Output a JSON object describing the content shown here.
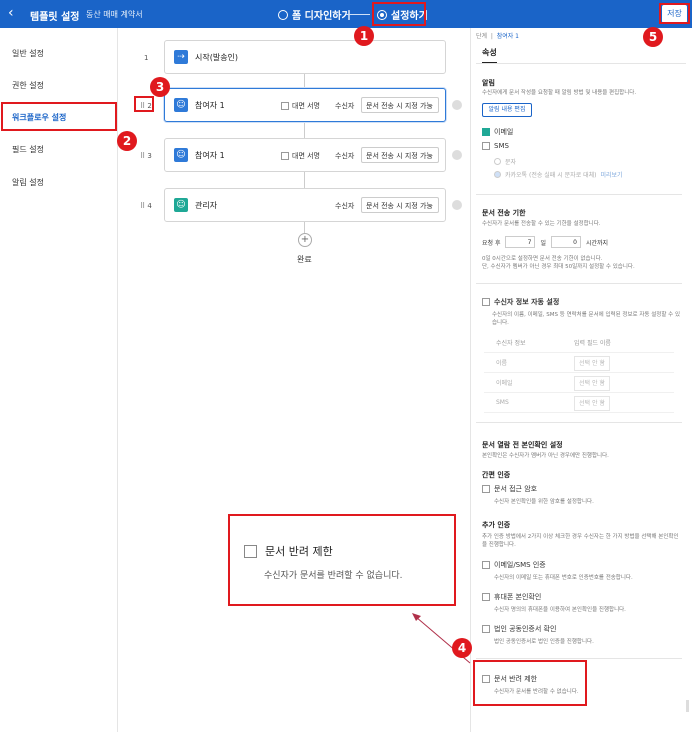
{
  "header": {
    "back_icon": "chevron-left-icon",
    "title": "템플릿 설정",
    "subtitle": "동산 매매 계약서",
    "steps": [
      {
        "label": "폼 디자인하기",
        "selected": false
      },
      {
        "label": "설정하기",
        "selected": true
      }
    ],
    "save_label": "저장"
  },
  "sidebar": {
    "items": [
      {
        "label": "일반 설정",
        "active": false
      },
      {
        "label": "권한 설정",
        "active": false
      },
      {
        "label": "워크플로우 설정",
        "active": true
      },
      {
        "label": "필드 설정",
        "active": false
      },
      {
        "label": "알림 설정",
        "active": false
      }
    ]
  },
  "workflow": {
    "nodes": [
      {
        "num": "1",
        "label": "시작(발송인)",
        "icon": "user-send-icon"
      },
      {
        "num": "2",
        "label": "참여자 1",
        "icon": "user-icon",
        "face_to_face": "대면 서명",
        "recipient": "수신자",
        "select": "문서 전송 시 지정 가능"
      },
      {
        "num": "3",
        "label": "참여자 1",
        "icon": "user-icon",
        "face_to_face": "대면 서명",
        "recipient": "수신자",
        "select": "문서 전송 시 지정 가능"
      },
      {
        "num": "4",
        "label": "관리자",
        "icon": "admin-icon",
        "recipient": "수신자",
        "select": "문서 전송 시 지정 가능"
      }
    ],
    "done_label": "완료"
  },
  "panel": {
    "crumb_root": "단계",
    "crumb_current": "참여자 1",
    "tab": "속성",
    "notify": {
      "title": "알림",
      "desc": "수신자에게 문서 작성을 요청할 때 알림 방법 및 내용을 편집합니다.",
      "edit_btn": "알림 내용 편집",
      "email": "이메일",
      "sms": "SMS",
      "opt_text": "문자",
      "opt_kakao": "카카오톡 (전송 실패 시 문자로 대체)",
      "preview": "미리보기"
    },
    "deadline": {
      "title": "문서 전송 기한",
      "desc": "수신자가 문서를 전송할 수 있는 기한을 설정합니다.",
      "prefix": "요청 후",
      "days_value": "7",
      "days_unit": "일",
      "hours_value": "0",
      "hours_unit": "시간까지",
      "note1": "0일 0시간으로 설정하면 문서 전송 기한이 없습니다.",
      "note2": "단, 수신자가 멤버가 아닌 경우 최대 50일까지 설정할 수 있습니다."
    },
    "autofill": {
      "title": "수신자 정보 자동 설정",
      "desc": "수신자의 이름, 이메일, SMS 등 연락처를 문서에 입력된 정보로 자동 설정할 수 있습니다.",
      "col1": "수신자 정보",
      "col2": "입력 필드 이름",
      "rows": [
        {
          "name": "이름",
          "value": "선택 안 함"
        },
        {
          "name": "이메일",
          "value": "선택 안 함"
        },
        {
          "name": "SMS",
          "value": "선택 안 함"
        }
      ]
    },
    "verify": {
      "title": "문서 열람 전 본인확인 설정",
      "desc": "본인확인은 수신자가 멤버가 아닌 경우에만 진행합니다.",
      "simple_title": "간편 인증",
      "pw_label": "문서 접근 암호",
      "pw_desc": "수신자 본인확인을 위한 암호를 설정합니다.",
      "extra_title": "추가 인증",
      "extra_desc": "추가 인증 방법에서 2가지 이상 체크한 경우 수신자는 한 가지 방법을 선택해 본인확인을 진행합니다.",
      "email_sms": "이메일/SMS 인증",
      "email_sms_desc": "수신자의 이메일 또는 휴대폰 번호로 인증번호를 전송합니다.",
      "phone": "휴대폰 본인확인",
      "phone_desc": "수신자 명의의 휴대폰을 이용하여 본인확인을 진행합니다.",
      "cert": "법인 공동인증서 확인",
      "cert_desc": "법인 공동인증서로 법인 인증을 진행합니다."
    },
    "reject": {
      "label": "문서 반려 제한",
      "desc": "수신자가 문서를 반려할 수 없습니다."
    }
  },
  "callout": {
    "label": "문서 반려 제한",
    "desc": "수신자가 문서를 반려할 수 없습니다."
  },
  "badges": [
    "1",
    "2",
    "3",
    "4",
    "5"
  ],
  "colors": {
    "brand": "#1a64c8",
    "highlight": "#e0191e",
    "teal": "#1fa896"
  }
}
